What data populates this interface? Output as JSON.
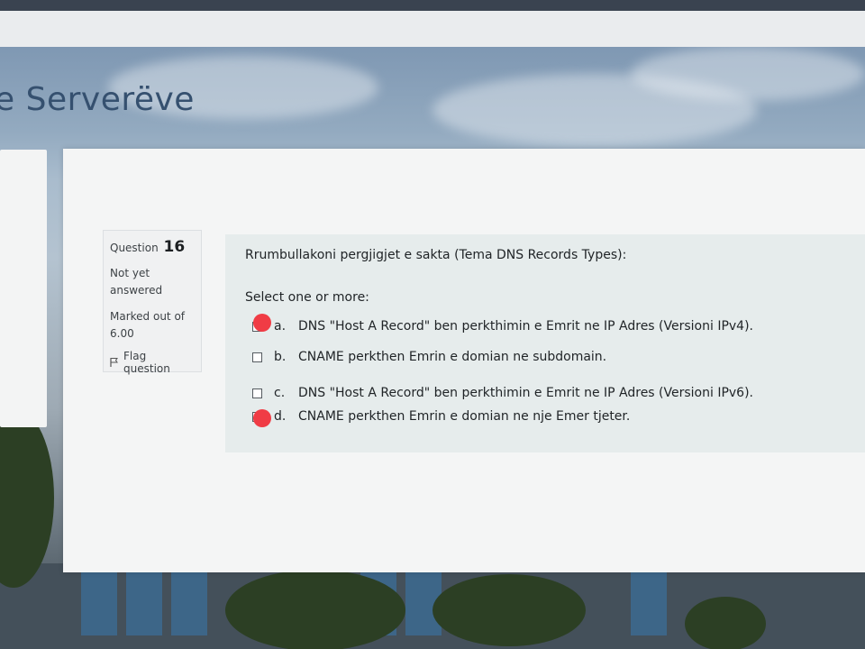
{
  "page": {
    "title_partial": "e Serverëve"
  },
  "question": {
    "label": "Question",
    "number": "16",
    "status": "Not yet answered",
    "marked_label": "Marked out of",
    "marked_value": "6.00",
    "flag_label": "Flag question"
  },
  "prompt": "Rrumbullakoni pergjigjet e sakta (Tema DNS Records Types):",
  "select_hint": "Select one or more:",
  "options": [
    {
      "letter": "a.",
      "text": "DNS \"Host A Record\" ben perkthimin e Emrit ne IP Adres (Versioni IPv4).",
      "marked": true
    },
    {
      "letter": "b.",
      "text": "CNAME perkthen Emrin e domian ne subdomain.",
      "marked": false
    },
    {
      "letter": "c.",
      "text": "DNS \"Host A Record\" ben perkthimin e Emrit ne IP Adres (Versioni IPv6).",
      "marked": false
    },
    {
      "letter": "d.",
      "text": "CNAME perkthen Emrin e domian ne nje Emer tjeter.",
      "marked": true
    }
  ],
  "colors": {
    "mark": "#f03c45",
    "title": "#35506f"
  }
}
